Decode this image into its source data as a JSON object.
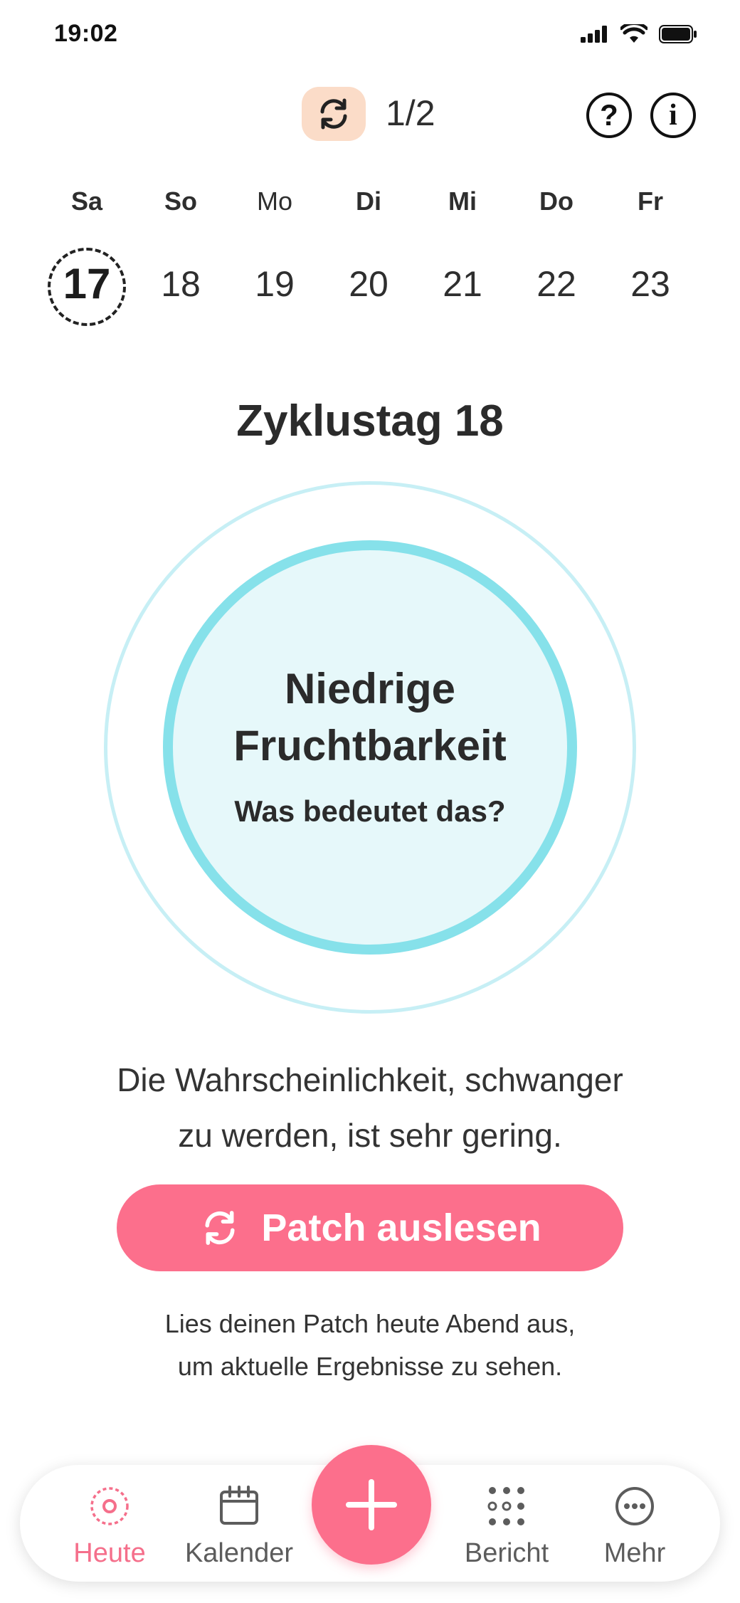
{
  "status_bar": {
    "time": "19:02"
  },
  "header": {
    "cycle_counter": "1/2",
    "help_glyph": "?",
    "info_glyph": "i"
  },
  "week": {
    "days": [
      {
        "weekday": "Sa",
        "date": "17",
        "today": true
      },
      {
        "weekday": "So",
        "date": "18"
      },
      {
        "weekday": "Mo",
        "date": "19"
      },
      {
        "weekday": "Di",
        "date": "20"
      },
      {
        "weekday": "Mi",
        "date": "21"
      },
      {
        "weekday": "Do",
        "date": "22"
      },
      {
        "weekday": "Fr",
        "date": "23"
      }
    ]
  },
  "cycle_day_title": "Zyklustag 18",
  "fertility": {
    "line1": "Niedrige",
    "line2": "Fruchtbarkeit",
    "link": "Was bedeutet das?"
  },
  "description": {
    "line1": "Die Wahrscheinlichkeit, schwanger",
    "line2": "zu werden, ist sehr gering."
  },
  "read_button_label": "Patch auslesen",
  "hint": {
    "line1": "Lies deinen Patch heute Abend aus,",
    "line2": "um aktuelle Ergebnisse zu sehen."
  },
  "nav": {
    "today": "Heute",
    "calendar": "Kalender",
    "report": "Bericht",
    "more": "Mehr"
  },
  "colors": {
    "accent": "#fc6f8c",
    "ring_outer": "#c7eff5",
    "ring_inner": "#86e1ea",
    "ring_fill": "#e6f8fa",
    "sync_chip": "#fbdcc8"
  }
}
